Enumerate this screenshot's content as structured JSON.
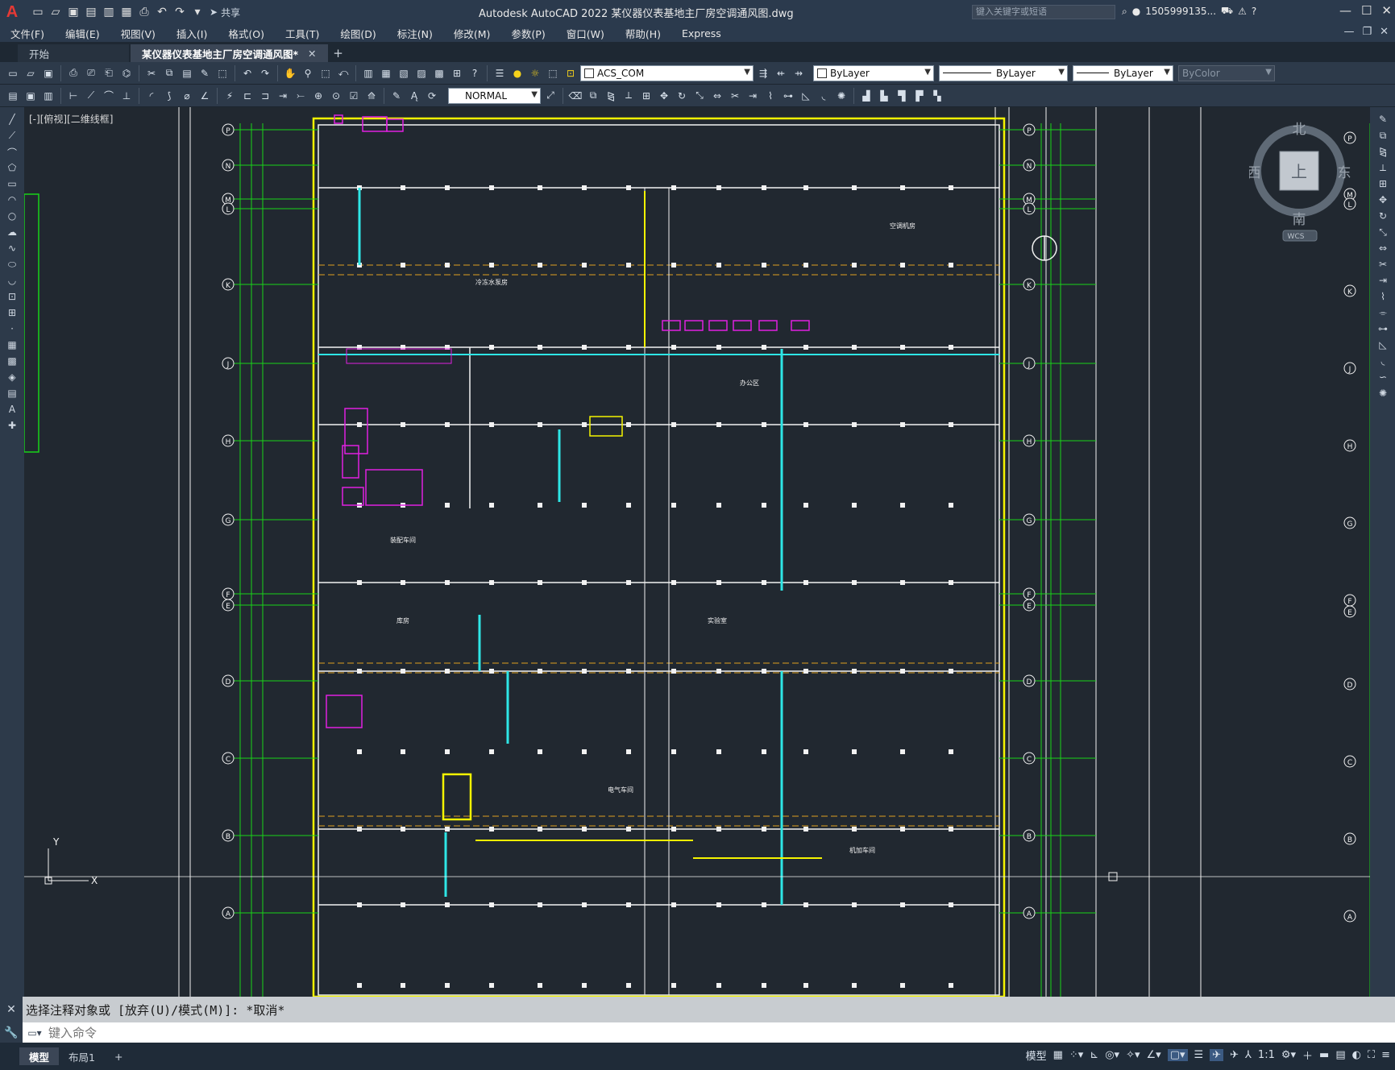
{
  "app": {
    "logo_letter": "A",
    "title": "Autodesk AutoCAD 2022    某仪器仪表基地主厂房空调通风图.dwg",
    "share_label": "共享",
    "search_placeholder": "键入关键字或短语",
    "user_name": "1505999135..."
  },
  "menu": [
    "文件(F)",
    "编辑(E)",
    "视图(V)",
    "插入(I)",
    "格式(O)",
    "工具(T)",
    "绘图(D)",
    "标注(N)",
    "修改(M)",
    "参数(P)",
    "窗口(W)",
    "帮助(H)",
    "Express"
  ],
  "tabs": {
    "start": "开始",
    "drawing": "某仪器仪表基地主厂房空调通风图*"
  },
  "properties": {
    "layer": "ACS_COM",
    "color": "ByLayer",
    "linetype": "ByLayer",
    "lineweight": "ByLayer",
    "plotstyle": "ByColor",
    "dimstyle": "NORMAL"
  },
  "viewport": {
    "label": "[-][俯视][二维线框]"
  },
  "viewcube": {
    "north": "北",
    "south": "南",
    "east": "东",
    "west": "西",
    "top": "上",
    "wcs": "WCS"
  },
  "command": {
    "history": "选择注释对象或 [放弃(U)/模式(M)]: *取消*",
    "placeholder": "键入命令"
  },
  "layout_tabs": {
    "model": "模型",
    "layout1": "布局1"
  },
  "status": {
    "model_label": "模型",
    "scale": "1:1"
  },
  "drawing": {
    "axis_left": [
      "P",
      "N",
      "M",
      "L",
      "K",
      "J",
      "H",
      "G",
      "F",
      "E",
      "D",
      "C",
      "B",
      "A"
    ],
    "axis_right_outer": [
      "P",
      "M",
      "L",
      "K",
      "J",
      "H",
      "G",
      "F",
      "E",
      "D",
      "C",
      "B",
      "A"
    ],
    "room_labels": [
      "空调机房",
      "冷冻水泵房",
      "办公区",
      "装配车间",
      "库房",
      "实验室",
      "电气车间",
      "机加车间"
    ]
  }
}
